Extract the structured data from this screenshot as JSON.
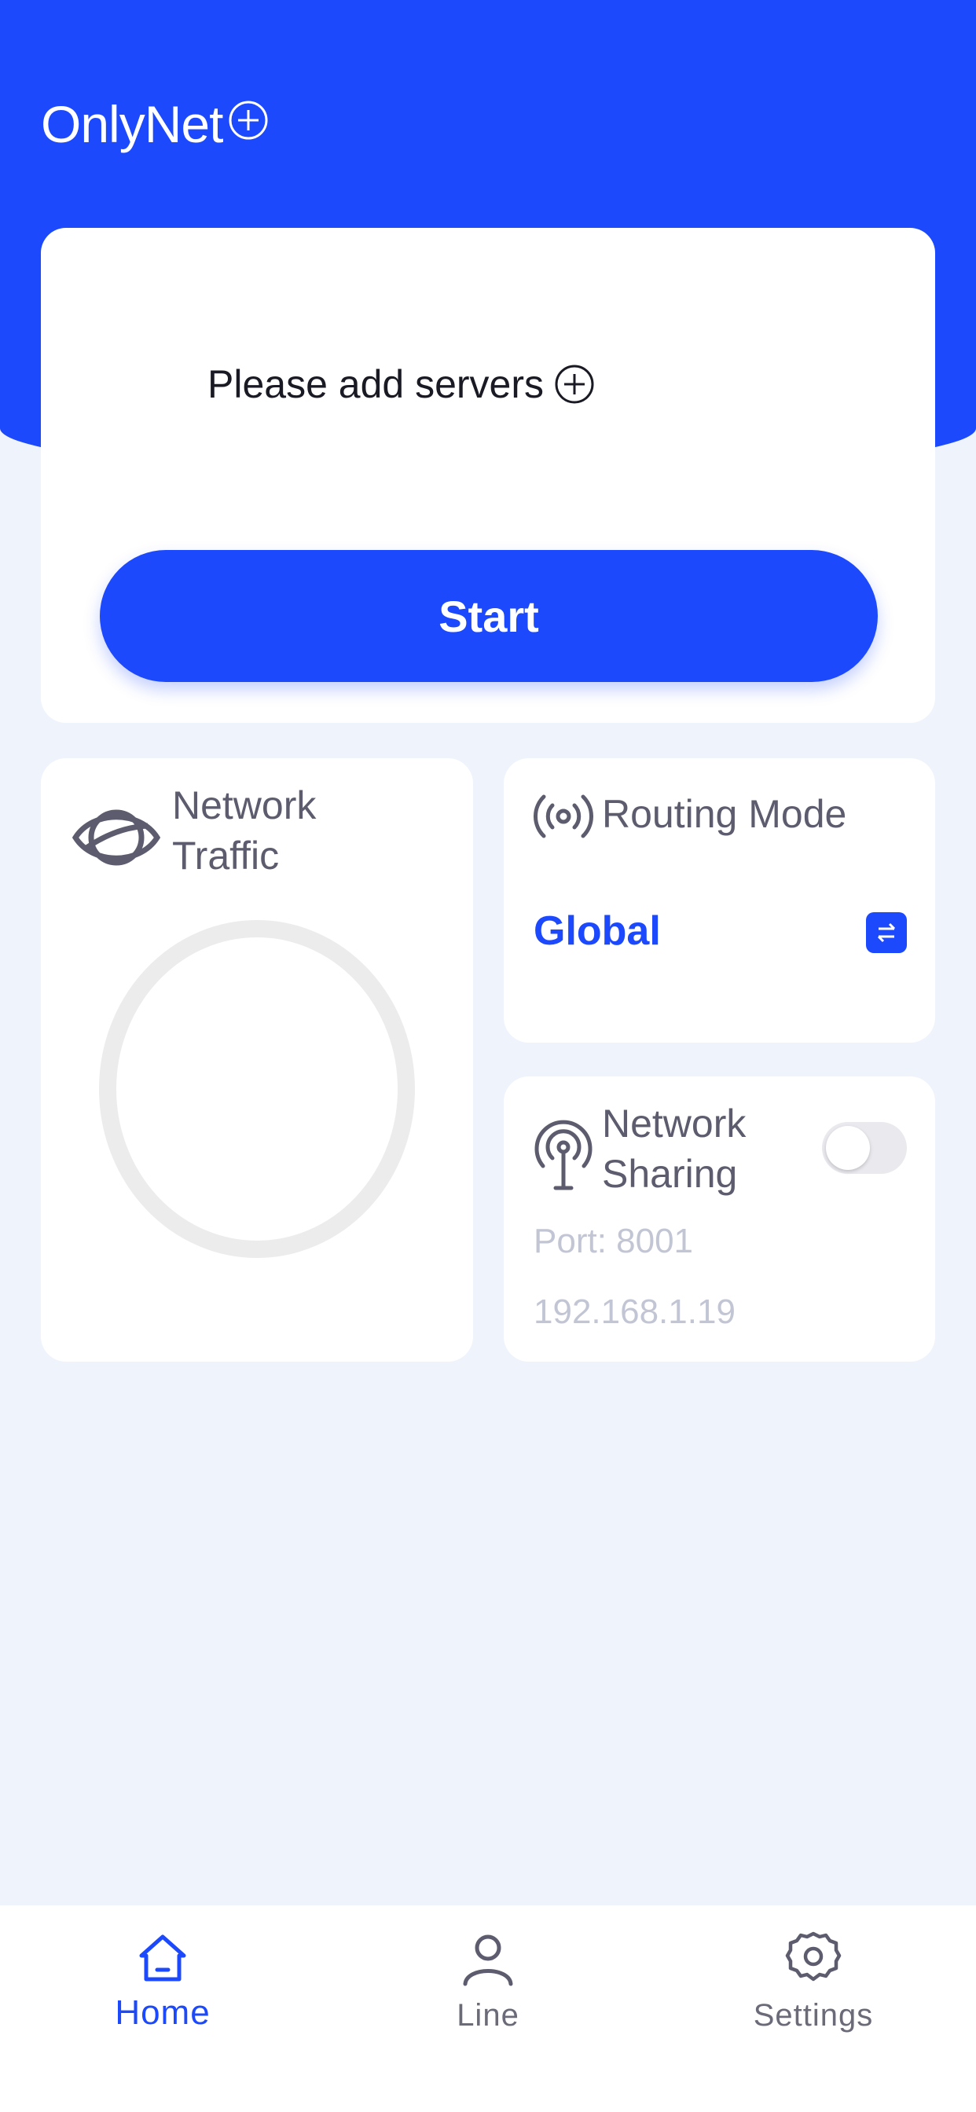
{
  "header": {
    "app_title": "OnlyNet",
    "title_icon": "plus-circle-icon",
    "background_color": "#1c49fb"
  },
  "server_card": {
    "prompt": "Please add servers",
    "prompt_icon": "plus-circle-icon",
    "start_label": "Start"
  },
  "network_traffic": {
    "title": "Network Traffic",
    "icon": "planet-icon"
  },
  "routing_mode": {
    "title": "Routing Mode",
    "icon": "broadcast-icon",
    "value": "Global",
    "switch_icon": "swap-icon"
  },
  "network_sharing": {
    "title": "Network Sharing",
    "icon": "antenna-icon",
    "enabled": false,
    "port": "Port: 8001",
    "ip": "192.168.1.19"
  },
  "tabbar": {
    "tabs": [
      {
        "label": "Home",
        "icon": "home-icon",
        "active": true
      },
      {
        "label": "Line",
        "icon": "user-icon",
        "active": false
      },
      {
        "label": "Settings",
        "icon": "gear-icon",
        "active": false
      }
    ]
  },
  "colors": {
    "accent": "#1c49fb",
    "background": "#eff3fc",
    "card": "#ffffff",
    "muted_text": "#c2c5d4"
  }
}
